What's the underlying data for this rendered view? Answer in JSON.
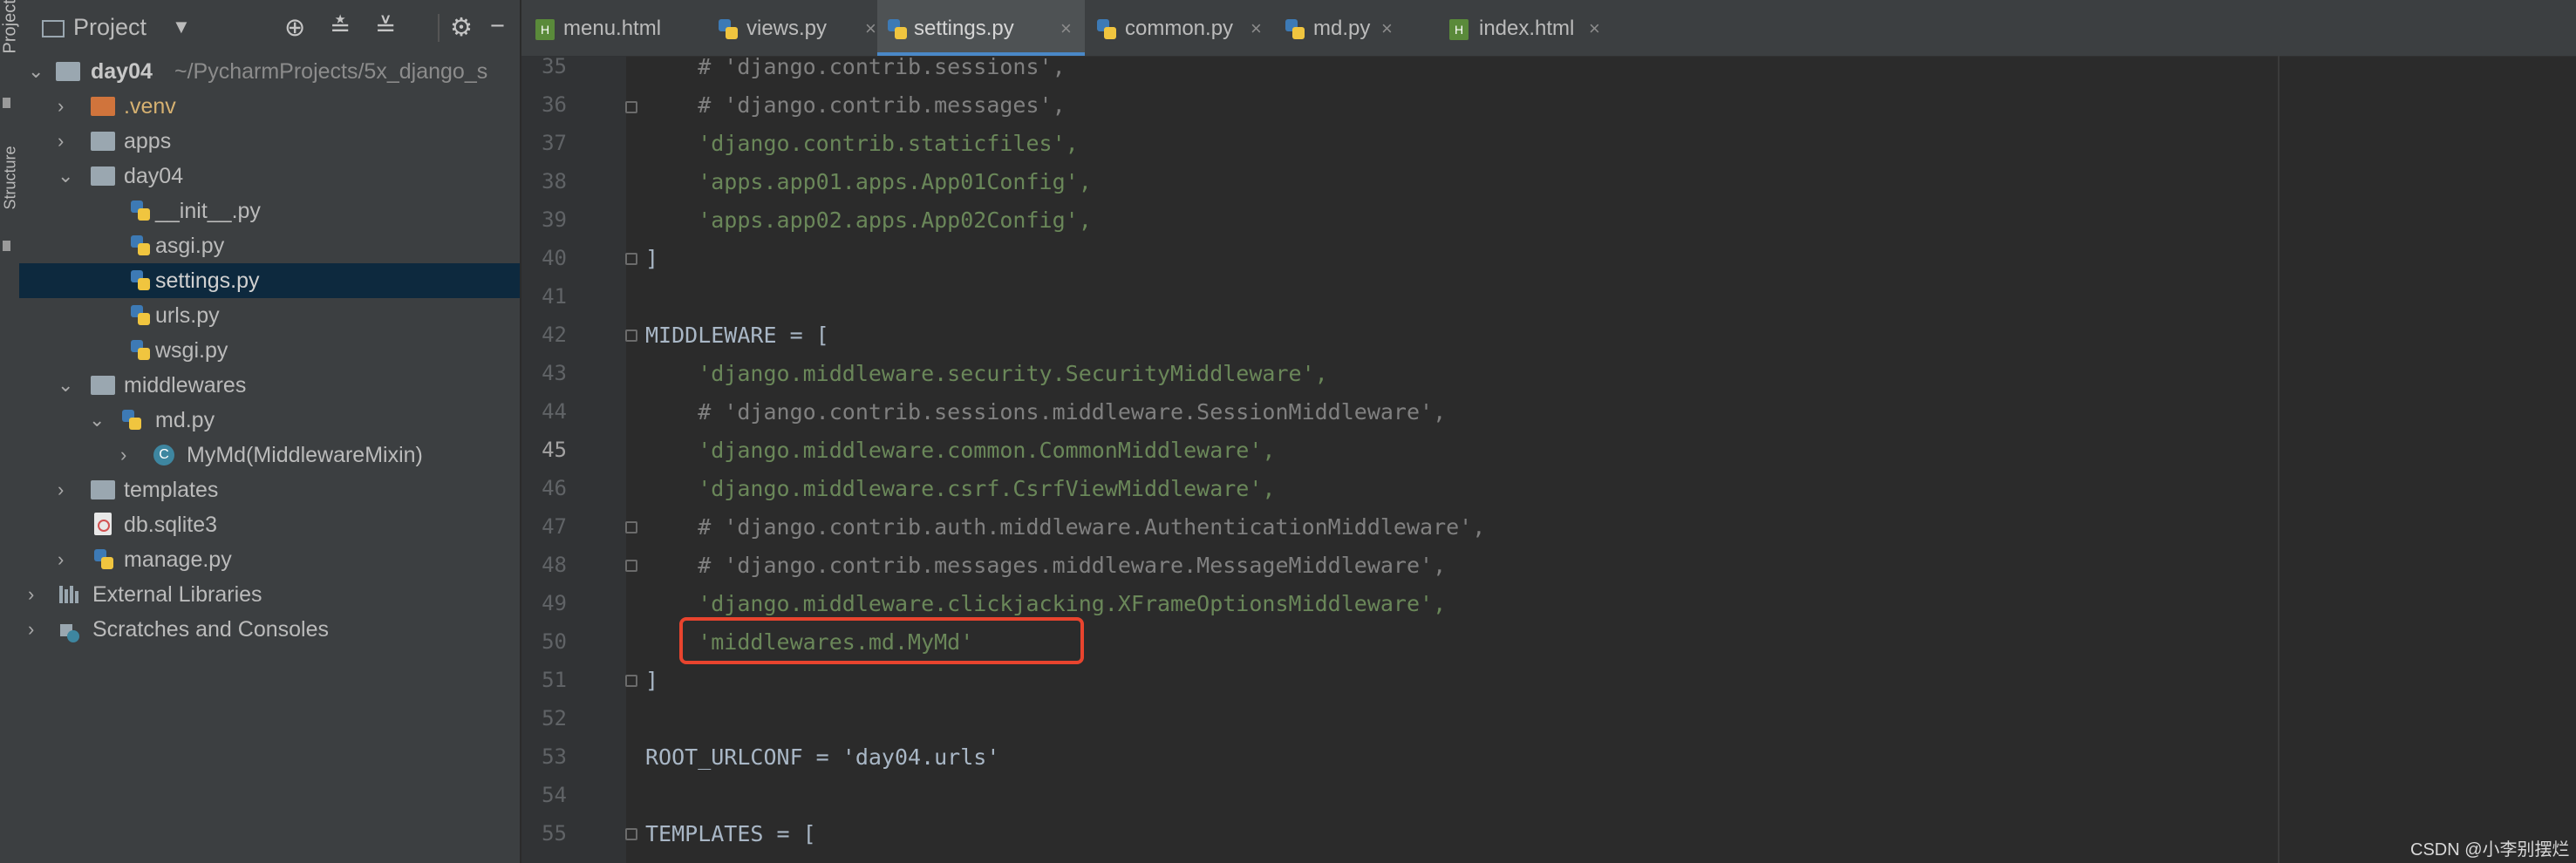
{
  "sidebar_strip": {
    "project_label": "Project",
    "structure_label": "Structure"
  },
  "project_panel": {
    "title": "Project",
    "tree": [
      {
        "label": "day04",
        "extra": "~/PycharmProjects/5x_django_s",
        "icon": "folder-icon"
      },
      {
        "label": ".venv",
        "icon": "folder-orange-icon"
      },
      {
        "label": "apps",
        "icon": "folder-icon"
      },
      {
        "label": "day04",
        "icon": "folder-module-icon"
      },
      {
        "label": "__init__.py",
        "icon": "python-file-icon"
      },
      {
        "label": "asgi.py",
        "icon": "python-file-icon"
      },
      {
        "label": "settings.py",
        "icon": "python-file-icon"
      },
      {
        "label": "urls.py",
        "icon": "python-file-icon"
      },
      {
        "label": "wsgi.py",
        "icon": "python-file-icon"
      },
      {
        "label": "middlewares",
        "icon": "folder-icon"
      },
      {
        "label": "md.py",
        "icon": "python-file-icon"
      },
      {
        "label": "MyMd(MiddlewareMixin)",
        "icon": "class-icon",
        "class_letter": "C"
      },
      {
        "label": "templates",
        "icon": "folder-icon"
      },
      {
        "label": "db.sqlite3",
        "icon": "database-file-icon"
      },
      {
        "label": "manage.py",
        "icon": "python-file-icon"
      },
      {
        "label": "External Libraries",
        "icon": "libraries-icon"
      },
      {
        "label": "Scratches and Consoles",
        "icon": "scratches-icon"
      }
    ]
  },
  "tabs": [
    {
      "label": "menu.html",
      "icon": "html-file-icon"
    },
    {
      "label": "views.py",
      "icon": "python-file-icon"
    },
    {
      "label": "settings.py",
      "icon": "python-file-icon",
      "active": true
    },
    {
      "label": "common.py",
      "icon": "python-file-icon"
    },
    {
      "label": "md.py",
      "icon": "python-file-icon"
    },
    {
      "label": "index.html",
      "icon": "html-file-icon"
    }
  ],
  "html_icon_letter": "H",
  "close_glyph": "×",
  "editor": {
    "current_line": "45",
    "lines": [
      {
        "num": "35",
        "text": "    # 'django.contrib.sessions',"
      },
      {
        "num": "36",
        "text": "    # 'django.contrib.messages',"
      },
      {
        "num": "37",
        "text": "    'django.contrib.staticfiles',"
      },
      {
        "num": "38",
        "text": "    'apps.app01.apps.App01Config',"
      },
      {
        "num": "39",
        "text": "    'apps.app02.apps.App02Config',"
      },
      {
        "num": "40",
        "text": "]"
      },
      {
        "num": "41",
        "text": ""
      },
      {
        "num": "42",
        "text": "MIDDLEWARE = ["
      },
      {
        "num": "43",
        "text": "    'django.middleware.security.SecurityMiddleware',"
      },
      {
        "num": "44",
        "text": "    # 'django.contrib.sessions.middleware.SessionMiddleware',"
      },
      {
        "num": "45",
        "text": "    'django.middleware.common.CommonMiddleware',"
      },
      {
        "num": "46",
        "text": "    'django.middleware.csrf.CsrfViewMiddleware',"
      },
      {
        "num": "47",
        "text": "    # 'django.contrib.auth.middleware.AuthenticationMiddleware',"
      },
      {
        "num": "48",
        "text": "    # 'django.contrib.messages.middleware.MessageMiddleware',"
      },
      {
        "num": "49",
        "text": "    'django.middleware.clickjacking.XFrameOptionsMiddleware',"
      },
      {
        "num": "50",
        "text": "    'middlewares.md.MyMd'"
      },
      {
        "num": "51",
        "text": "]"
      },
      {
        "num": "52",
        "text": ""
      },
      {
        "num": "53",
        "text": "ROOT_URLCONF = 'day04.urls'"
      },
      {
        "num": "54",
        "text": ""
      },
      {
        "num": "55",
        "text": "TEMPLATES = ["
      }
    ]
  },
  "watermark": "CSDN @小李别摆烂"
}
